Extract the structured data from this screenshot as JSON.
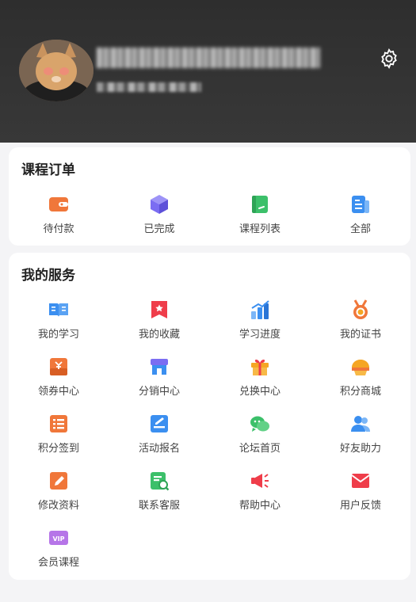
{
  "orders": {
    "title": "课程订单",
    "items": [
      {
        "label": "待付款",
        "icon": "wallet-icon"
      },
      {
        "label": "已完成",
        "icon": "cube-icon"
      },
      {
        "label": "课程列表",
        "icon": "notebook-icon"
      },
      {
        "label": "全部",
        "icon": "document-list-icon"
      }
    ]
  },
  "services": {
    "title": "我的服务",
    "items": [
      {
        "label": "我的学习",
        "icon": "book-icon"
      },
      {
        "label": "我的收藏",
        "icon": "bookmark-star-icon"
      },
      {
        "label": "学习进度",
        "icon": "bar-chart-icon"
      },
      {
        "label": "我的证书",
        "icon": "medal-icon"
      },
      {
        "label": "领券中心",
        "icon": "coupon-icon"
      },
      {
        "label": "分销中心",
        "icon": "shop-icon"
      },
      {
        "label": "兑换中心",
        "icon": "gift-icon"
      },
      {
        "label": "积分商城",
        "icon": "cake-icon"
      },
      {
        "label": "积分签到",
        "icon": "checklist-icon"
      },
      {
        "label": "活动报名",
        "icon": "signup-edit-icon"
      },
      {
        "label": "论坛首页",
        "icon": "chat-icon"
      },
      {
        "label": "好友助力",
        "icon": "friends-icon"
      },
      {
        "label": "修改资料",
        "icon": "edit-pencil-icon"
      },
      {
        "label": "联系客服",
        "icon": "service-search-icon"
      },
      {
        "label": "帮助中心",
        "icon": "megaphone-icon"
      },
      {
        "label": "用户反馈",
        "icon": "envelope-icon"
      },
      {
        "label": "会员课程",
        "icon": "vip-icon"
      }
    ]
  },
  "colors": {
    "header_bg": "#333333",
    "orange": "#f0773a",
    "purple": "#7b6df2",
    "green": "#3cc06a",
    "blue": "#3b8ff0",
    "red": "#ef3d4a",
    "gold": "#f5a623",
    "vip": "#b675e8"
  }
}
